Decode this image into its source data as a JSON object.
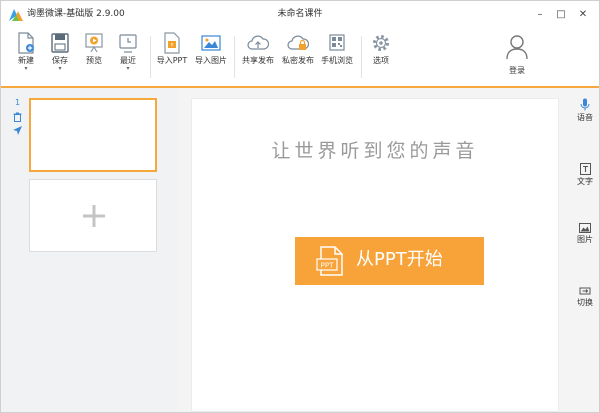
{
  "window": {
    "app_name": "询墨微课-基础版 2.9.00",
    "doc_title": "未命名课件",
    "controls": {
      "minimize": "–",
      "maximize": "□",
      "close": "✕"
    }
  },
  "toolbar": {
    "items": [
      {
        "label": "新建",
        "icon": "new-file-icon",
        "has_caret": true
      },
      {
        "label": "保存",
        "icon": "save-icon",
        "has_caret": true
      },
      {
        "label": "预览",
        "icon": "preview-icon",
        "has_caret": false
      },
      {
        "label": "最近",
        "icon": "recent-icon",
        "has_caret": true
      },
      {
        "label": "导入PPT",
        "icon": "import-ppt-icon",
        "has_caret": false
      },
      {
        "label": "导入图片",
        "icon": "import-image-icon",
        "has_caret": false
      },
      {
        "label": "共享发布",
        "icon": "share-publish-icon",
        "has_caret": false
      },
      {
        "label": "私密发布",
        "icon": "private-publish-icon",
        "has_caret": false
      },
      {
        "label": "手机浏览",
        "icon": "mobile-browse-icon",
        "has_caret": false
      },
      {
        "label": "选项",
        "icon": "options-gear-icon",
        "has_caret": false
      }
    ],
    "caret": "▾",
    "login_label": "登录"
  },
  "slides": {
    "current_number": "1",
    "add_label": "+"
  },
  "canvas": {
    "slogan": "让世界听到您的声音",
    "start_button_label": "从PPT开始",
    "ppt_icon_text": "PPT"
  },
  "side_tools": [
    {
      "label": "语音",
      "icon": "microphone-icon"
    },
    {
      "label": "文字",
      "icon": "text-icon"
    },
    {
      "label": "图片",
      "icon": "image-icon"
    },
    {
      "label": "切换",
      "icon": "transition-icon"
    }
  ],
  "colors": {
    "accent": "#f7a33a",
    "selection_border": "#f7a83c",
    "slide_number": "#3a87d6",
    "panel_bg": "#f1f2f4"
  }
}
